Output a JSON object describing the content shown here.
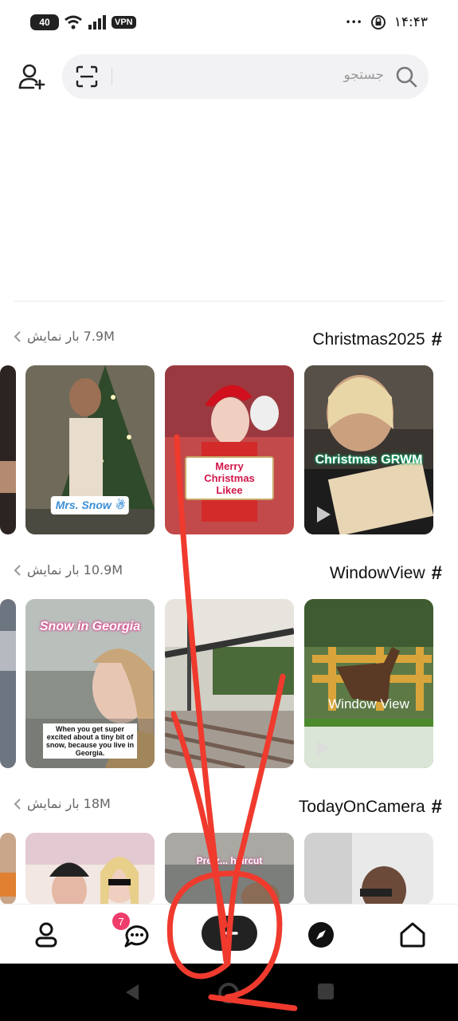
{
  "status_bar": {
    "battery": "40",
    "vpn": "VPN",
    "time": "۱۴:۴۳",
    "dots": "•••"
  },
  "search": {
    "placeholder": "جستجو"
  },
  "sections": [
    {
      "hashtag": "Christmas2025",
      "views": "7.9M بار نمایش",
      "captions": [
        "Christmas GRWM",
        "Merry Christmas Likee",
        "Mrs. Snow ☃"
      ]
    },
    {
      "hashtag": "WindowView",
      "views": "10.9M بار نمایش",
      "captions": [
        "Window View",
        "",
        "Snow in Georgia",
        "When you get super excited about a tiny bit of snow, because you live in Georgia."
      ]
    },
    {
      "hashtag": "TodayOnCamera",
      "views": "18M بار نمایش",
      "captions": [
        "",
        "Pretz... haircut",
        ""
      ]
    }
  ],
  "bottom_nav": {
    "messages_badge": "7",
    "items": [
      "home-icon",
      "compass-icon",
      "create-plus-icon",
      "messages-icon",
      "profile-icon"
    ]
  },
  "colors": {
    "accent_pink": "#ee3d6b",
    "annotation_red": "#f03a2e"
  }
}
